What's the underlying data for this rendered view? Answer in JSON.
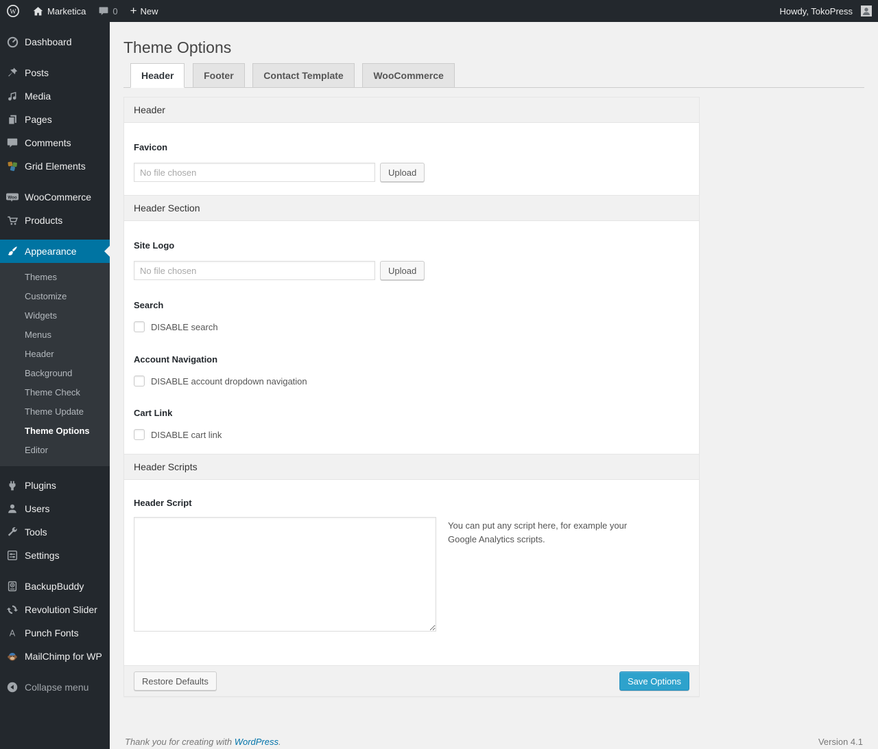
{
  "colors": {
    "admin_bar_bg": "#23282d",
    "menu_bg": "#23282d",
    "submenu_bg": "#32373c",
    "accent": "#0074a2",
    "primary_button_bg": "#2ea2cc",
    "primary_button_border": "#1e8cbe",
    "link": "#0073aa",
    "page_bg": "#f1f1f1"
  },
  "admin_bar": {
    "site_name": "Marketica",
    "comment_count": "0",
    "new_label": "New",
    "howdy": "Howdy, TokoPress"
  },
  "sidebar": {
    "items": [
      {
        "label": "Dashboard",
        "icon": "dashboard-icon"
      },
      {
        "label": "Posts",
        "icon": "pushpin-icon"
      },
      {
        "label": "Media",
        "icon": "media-icon"
      },
      {
        "label": "Pages",
        "icon": "pages-icon"
      },
      {
        "label": "Comments",
        "icon": "comment-icon"
      },
      {
        "label": "Grid Elements",
        "icon": "grid-elements-icon"
      },
      {
        "label": "WooCommerce",
        "icon": "woocommerce-icon"
      },
      {
        "label": "Products",
        "icon": "cart-icon"
      },
      {
        "label": "Appearance",
        "icon": "appearance-icon"
      },
      {
        "label": "Plugins",
        "icon": "plugin-icon"
      },
      {
        "label": "Users",
        "icon": "user-icon"
      },
      {
        "label": "Tools",
        "icon": "wrench-icon"
      },
      {
        "label": "Settings",
        "icon": "settings-icon"
      },
      {
        "label": "BackupBuddy",
        "icon": "backup-drive-icon"
      },
      {
        "label": "Revolution Slider",
        "icon": "refresh-icon"
      },
      {
        "label": "Punch Fonts",
        "icon": "font-a-icon"
      },
      {
        "label": "MailChimp for WP",
        "icon": "mailchimp-icon"
      },
      {
        "label": "Collapse menu",
        "icon": "collapse-arrow-icon"
      }
    ],
    "appearance_submenu": [
      "Themes",
      "Customize",
      "Widgets",
      "Menus",
      "Header",
      "Background",
      "Theme Check",
      "Theme Update",
      "Theme Options",
      "Editor"
    ],
    "current_item": "Appearance",
    "current_submenu_item": "Theme Options"
  },
  "page": {
    "title": "Theme Options",
    "tabs": [
      {
        "label": "Header",
        "active": true
      },
      {
        "label": "Footer",
        "active": false
      },
      {
        "label": "Contact Template",
        "active": false
      },
      {
        "label": "WooCommerce",
        "active": false
      }
    ]
  },
  "panel": {
    "heads": {
      "header": "Header",
      "header_section": "Header Section",
      "header_scripts": "Header Scripts"
    },
    "favicon": {
      "label": "Favicon",
      "file_placeholder": "No file chosen",
      "upload_label": "Upload"
    },
    "site_logo": {
      "label": "Site Logo",
      "file_placeholder": "No file chosen",
      "upload_label": "Upload"
    },
    "search": {
      "label": "Search",
      "checkbox_label": "DISABLE search",
      "checked": false
    },
    "account_navigation": {
      "label": "Account Navigation",
      "checkbox_label": "DISABLE account dropdown navigation",
      "checked": false
    },
    "cart_link": {
      "label": "Cart Link",
      "checkbox_label": "DISABLE cart link",
      "checked": false
    },
    "header_script": {
      "label": "Header Script",
      "value": "",
      "hint": "You can put any script here, for example your Google Analytics scripts."
    },
    "footer": {
      "restore_label": "Restore Defaults",
      "save_label": "Save Options"
    }
  },
  "footer": {
    "thanks_text": "Thank you for creating with",
    "wordpress_link": "WordPress",
    "period": ".",
    "version": "Version 4.1"
  }
}
